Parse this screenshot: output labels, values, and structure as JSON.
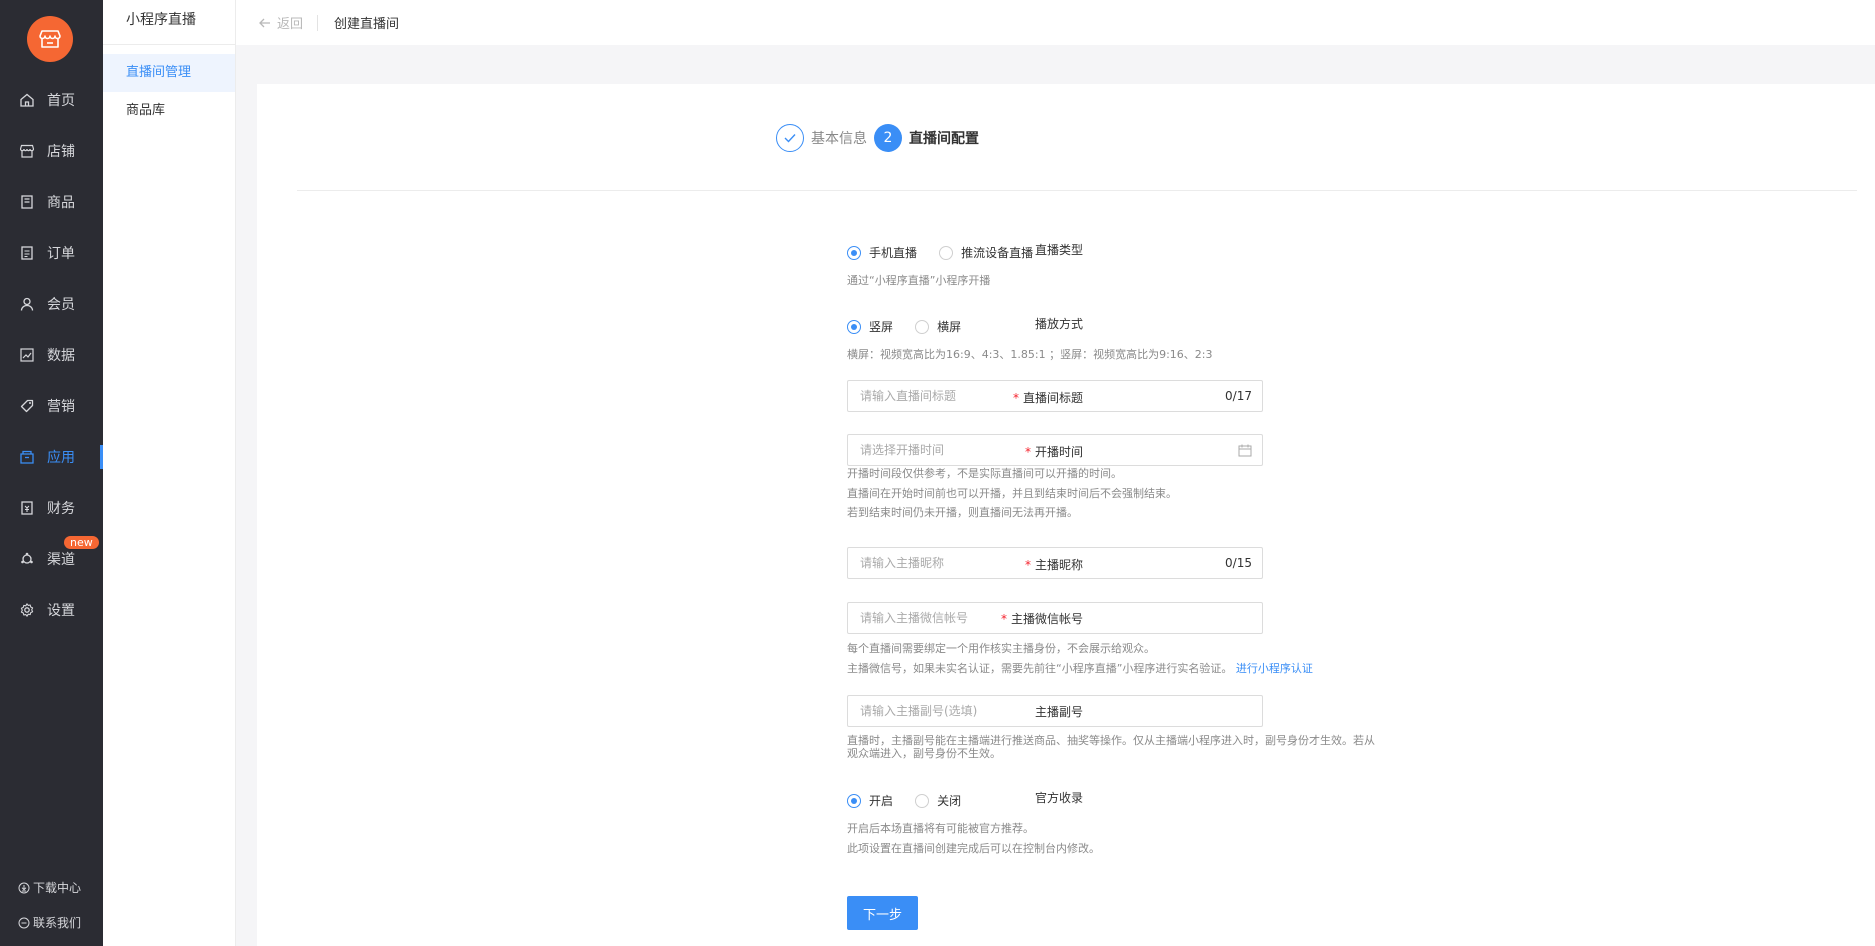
{
  "nav": {
    "items": [
      {
        "label": "首页",
        "icon": "home-icon"
      },
      {
        "label": "店铺",
        "icon": "store-icon"
      },
      {
        "label": "商品",
        "icon": "goods-icon"
      },
      {
        "label": "订单",
        "icon": "order-icon"
      },
      {
        "label": "会员",
        "icon": "member-icon"
      },
      {
        "label": "数据",
        "icon": "chart-icon"
      },
      {
        "label": "营销",
        "icon": "tag-icon"
      },
      {
        "label": "应用",
        "icon": "app-icon",
        "active": true
      },
      {
        "label": "财务",
        "icon": "finance-icon"
      },
      {
        "label": "渠道",
        "icon": "channel-icon",
        "badge": "new"
      },
      {
        "label": "设置",
        "icon": "settings-icon"
      }
    ],
    "download_center": "下载中心",
    "contact_us": "联系我们"
  },
  "sub_nav": {
    "title": "小程序直播",
    "items": [
      "直播间管理",
      "商品库"
    ]
  },
  "topbar": {
    "back_label": "返回",
    "breadcrumb": "创建直播间"
  },
  "steps": [
    {
      "label": "基本信息",
      "state": "done"
    },
    {
      "number": "2",
      "label": "直播间配置",
      "state": "current"
    }
  ],
  "form": {
    "live_type": {
      "label": "直播类型",
      "options": [
        "手机直播",
        "推流设备直播"
      ],
      "hint": "通过“小程序直播”小程序开播"
    },
    "play_mode": {
      "label": "播放方式",
      "options": [
        "竖屏",
        "横屏"
      ],
      "hint": "横屏：视频宽高比为16:9、4:3、1.85:1 ；竖屏：视频宽高比为9:16、2:3"
    },
    "title": {
      "label": "直播间标题",
      "placeholder": "请输入直播间标题",
      "count": "0/17"
    },
    "start_time": {
      "label": "开播时间",
      "placeholder": "请选择开播时间",
      "hints": [
        "开播时间段仅供参考，不是实际直播间可以开播的时间。",
        "直播间在开始时间前也可以开播，并且到结束时间后不会强制结束。",
        "若到结束时间仍未开播，则直播间无法再开播。"
      ]
    },
    "anchor_name": {
      "label": "主播昵称",
      "placeholder": "请输入主播昵称",
      "count": "0/15"
    },
    "anchor_wechat": {
      "label": "主播微信帐号",
      "placeholder": "请输入主播微信帐号",
      "hint1": "每个直播间需要绑定一个用作核实主播身份，不会展示给观众。",
      "hint2": "主播微信号，如果未实名认证，需要先前往“小程序直播”小程序进行实名验证。",
      "hint2_link": "进行小程序认证"
    },
    "sub_anchor": {
      "label": "主播副号",
      "placeholder": "请输入主播副号(选填)",
      "hint_line1": "直播时，主播副号能在主播端进行推送商品、抽奖等操作。仅从主播端小程序进入时，副号身份才生效。若从",
      "hint_line2": "观众端进入，副号身份不生效。"
    },
    "official": {
      "label": "官方收录",
      "options": [
        "开启",
        "关闭"
      ],
      "hints": [
        "开启后本场直播将有可能被官方推荐。",
        "此项设置在直播间创建完成后可以在控制台内修改。"
      ]
    },
    "next_button": "下一步"
  },
  "colors": {
    "accent": "#3a8ef6",
    "brand": "#f56733",
    "nav_bg": "#2b2c33",
    "required": "#f5222d"
  }
}
